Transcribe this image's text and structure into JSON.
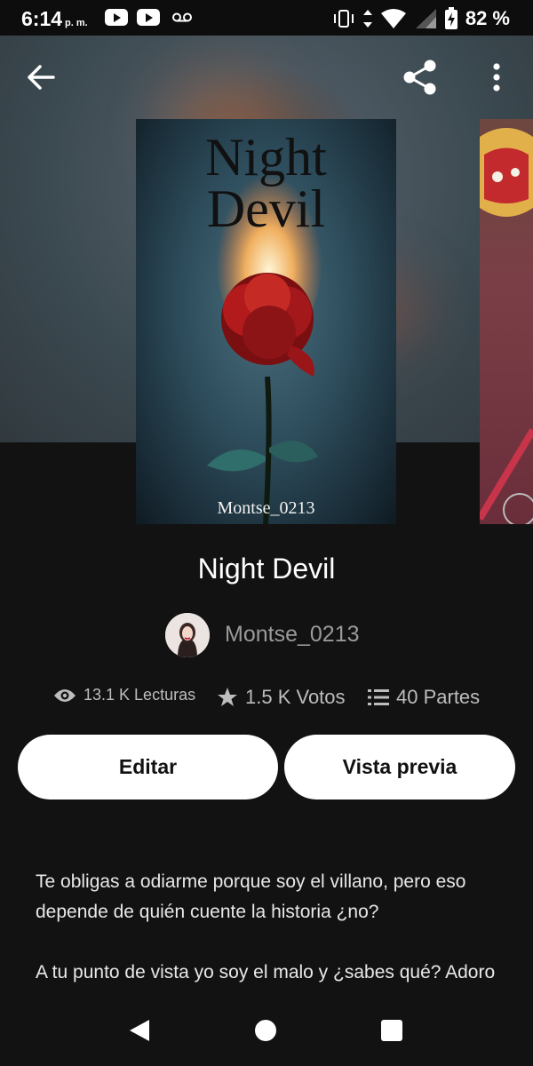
{
  "status_bar": {
    "time": "6:14",
    "ampm": "p. m.",
    "battery_percent": "82 %",
    "icons": [
      "youtube-icon",
      "youtube-icon",
      "voicemail-icon",
      "vibrate-icon",
      "data-arrows-icon",
      "wifi-icon",
      "signal-icon",
      "battery-charging-icon"
    ]
  },
  "toolbar": {
    "back_icon": "arrow-left-icon",
    "share_icon": "share-icon",
    "more_icon": "more-vert-icon"
  },
  "cover": {
    "title_line1": "Night",
    "title_line2": "Devil",
    "author": "Montse_0213"
  },
  "story": {
    "title": "Night Devil",
    "author": "Montse_0213"
  },
  "stats": {
    "reads": "13.1 K Lecturas",
    "votes": "1.5 K Votos",
    "parts": "40 Partes"
  },
  "actions": {
    "edit_label": "Editar",
    "preview_label": "Vista previa"
  },
  "description": {
    "paragraph1": "Te obligas a odiarme porque soy el villano, pero eso depende de quién cuente la historia ¿no?",
    "paragraph2": "A tu punto de vista yo soy el malo y ¿sabes qué? Adoro serlo."
  },
  "nav": {
    "icons": [
      "back-triangle-icon",
      "home-circle-icon",
      "recents-square-icon"
    ]
  },
  "colors": {
    "background": "#121212",
    "button_bg": "#ffffff",
    "muted_text": "#9a9a9a"
  }
}
